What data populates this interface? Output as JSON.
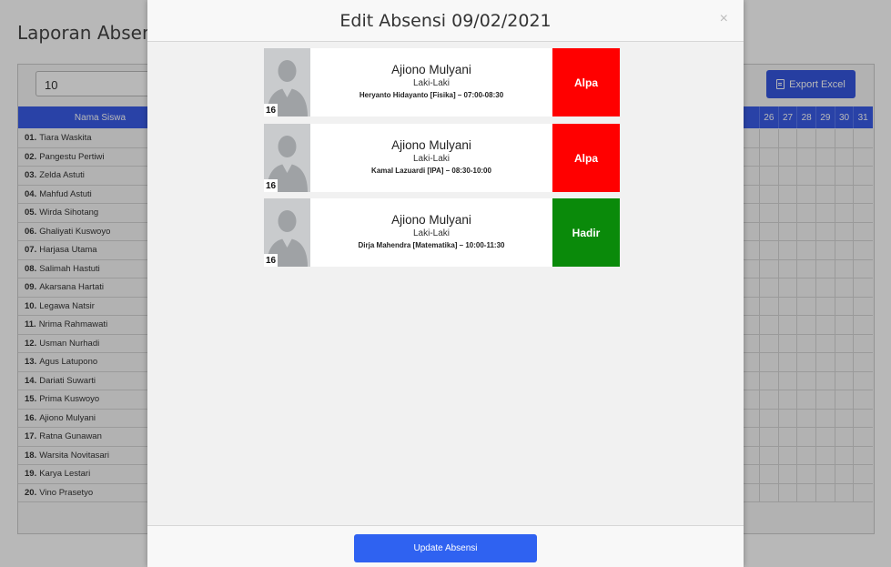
{
  "page": {
    "title": "Laporan Absensi"
  },
  "filter": {
    "value": "10",
    "clear_icon": "×"
  },
  "export": {
    "label": "Export Excel"
  },
  "table": {
    "name_header": "Nama Siswa",
    "days": [
      "26",
      "27",
      "28",
      "29",
      "30",
      "31"
    ],
    "students": [
      {
        "no": "01.",
        "name": "Tiara Waskita"
      },
      {
        "no": "02.",
        "name": "Pangestu Pertiwi"
      },
      {
        "no": "03.",
        "name": "Zelda Astuti"
      },
      {
        "no": "04.",
        "name": "Mahfud Astuti"
      },
      {
        "no": "05.",
        "name": "Wirda Sihotang"
      },
      {
        "no": "06.",
        "name": "Ghaliyati Kuswoyo"
      },
      {
        "no": "07.",
        "name": "Harjasa Utama"
      },
      {
        "no": "08.",
        "name": "Salimah Hastuti"
      },
      {
        "no": "09.",
        "name": "Akarsana Hartati"
      },
      {
        "no": "10.",
        "name": "Legawa Natsir"
      },
      {
        "no": "11.",
        "name": "Nrima Rahmawati"
      },
      {
        "no": "12.",
        "name": "Usman Nurhadi"
      },
      {
        "no": "13.",
        "name": "Agus Latupono"
      },
      {
        "no": "14.",
        "name": "Dariati Suwarti"
      },
      {
        "no": "15.",
        "name": "Prima Kuswoyo"
      },
      {
        "no": "16.",
        "name": "Ajiono Mulyani"
      },
      {
        "no": "17.",
        "name": "Ratna Gunawan"
      },
      {
        "no": "18.",
        "name": "Warsita Novitasari"
      },
      {
        "no": "19.",
        "name": "Karya Lestari"
      },
      {
        "no": "20.",
        "name": "Vino Prasetyo"
      }
    ]
  },
  "modal": {
    "title": "Edit Absensi 09/02/2021",
    "close_icon": "×",
    "update_label": "Update Absensi",
    "records": [
      {
        "number": "16",
        "name": "Ajiono Mulyani",
        "gender": "Laki-Laki",
        "schedule": "Heryanto Hidayanto [Fisika] – 07:00-08:30",
        "status": "Alpa",
        "status_color": "#ff0000"
      },
      {
        "number": "16",
        "name": "Ajiono Mulyani",
        "gender": "Laki-Laki",
        "schedule": "Kamal Lazuardi [IPA] – 08:30-10:00",
        "status": "Alpa",
        "status_color": "#ff0000"
      },
      {
        "number": "16",
        "name": "Ajiono Mulyani",
        "gender": "Laki-Laki",
        "schedule": "Dirja Mahendra [Matematika] – 10:00-11:30",
        "status": "Hadir",
        "status_color": "#0a8a0a"
      }
    ]
  },
  "colors": {
    "primary": "#3a5ce8",
    "button": "#2f62f1",
    "absent": "#ff0000",
    "present": "#0a8a0a"
  },
  "icons": {
    "export": "document-icon",
    "close": "close-icon",
    "avatar": "person-silhouette-icon"
  }
}
